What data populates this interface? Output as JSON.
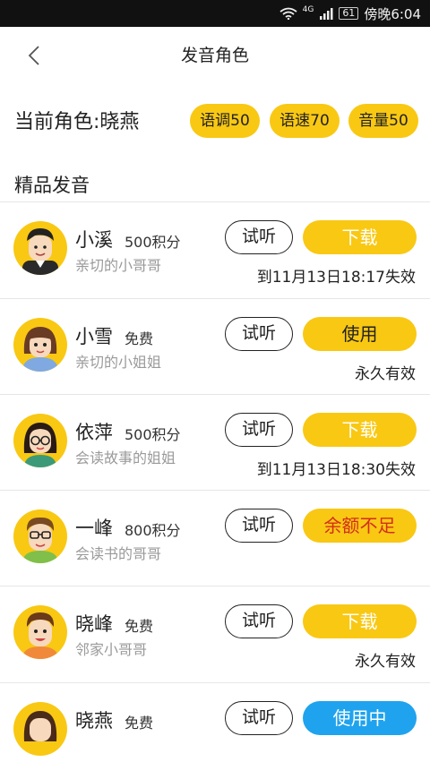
{
  "status_bar": {
    "network": "4G",
    "battery": "61",
    "time": "傍晚6:04"
  },
  "nav": {
    "title": "发音角色"
  },
  "current": {
    "label": "当前角色:",
    "name": "晓燕",
    "tone": "语调50",
    "speed": "语速70",
    "volume": "音量50"
  },
  "section": {
    "title": "精品发音"
  },
  "voices": [
    {
      "name": "小溪",
      "price": "500积分",
      "desc": "亲切的小哥哥",
      "listen": "试听",
      "action": "下载",
      "validity": "到11月13日18:17失效"
    },
    {
      "name": "小雪",
      "price": "免费",
      "desc": "亲切的小姐姐",
      "listen": "试听",
      "action": "使用",
      "validity": "永久有效"
    },
    {
      "name": "依萍",
      "price": "500积分",
      "desc": "会读故事的姐姐",
      "listen": "试听",
      "action": "下载",
      "validity": "到11月13日18:30失效"
    },
    {
      "name": "一峰",
      "price": "800积分",
      "desc": "会读书的哥哥",
      "listen": "试听",
      "action": "余额不足",
      "validity": ""
    },
    {
      "name": "晓峰",
      "price": "免费",
      "desc": "邻家小哥哥",
      "listen": "试听",
      "action": "下载",
      "validity": "永久有效"
    },
    {
      "name": "晓燕",
      "price": "免费",
      "desc": "",
      "listen": "试听",
      "action": "使用中",
      "validity": ""
    }
  ],
  "colors": {
    "accent": "#f9c813",
    "in_use": "#1fa3ee",
    "insufficient_text": "#d32e1a"
  }
}
